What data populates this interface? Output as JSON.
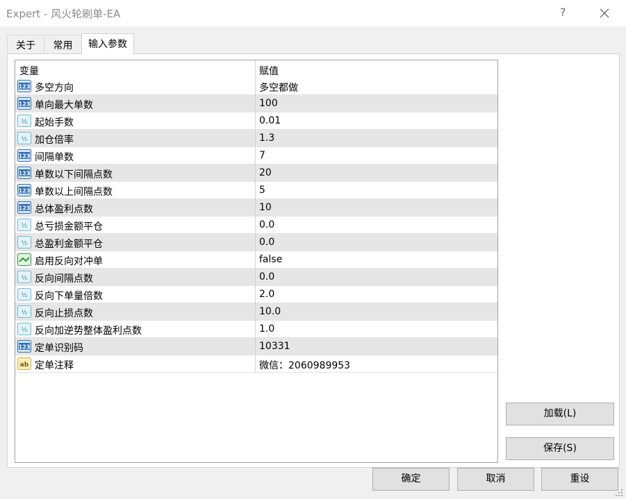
{
  "window": {
    "title": "Expert - 风火轮刷单-EA",
    "help_label": "?"
  },
  "tabs": [
    {
      "label": "关于"
    },
    {
      "label": "常用"
    },
    {
      "label": "输入参数"
    }
  ],
  "grid": {
    "col_variable": "变量",
    "col_value": "赋值",
    "rows": [
      {
        "icon": "integer-icon",
        "name": "多空方向",
        "value": "多空都做"
      },
      {
        "icon": "integer-icon",
        "name": "单向最大单数",
        "value": "100"
      },
      {
        "icon": "double-icon",
        "name": "起始手数",
        "value": "0.01"
      },
      {
        "icon": "double-icon",
        "name": "加仓倍率",
        "value": "1.3"
      },
      {
        "icon": "integer-icon",
        "name": "间隔单数",
        "value": "7"
      },
      {
        "icon": "integer-icon",
        "name": "单数以下间隔点数",
        "value": "20"
      },
      {
        "icon": "integer-icon",
        "name": "单数以上间隔点数",
        "value": "5"
      },
      {
        "icon": "integer-icon",
        "name": "总体盈利点数",
        "value": "10"
      },
      {
        "icon": "double-icon",
        "name": "总亏损金额平仓",
        "value": "0.0"
      },
      {
        "icon": "double-icon",
        "name": "总盈利金额平仓",
        "value": "0.0"
      },
      {
        "icon": "bool-icon",
        "name": "启用反向对冲单",
        "value": "false"
      },
      {
        "icon": "double-icon",
        "name": "反向间隔点数",
        "value": "0.0"
      },
      {
        "icon": "double-icon",
        "name": "反向下单量倍数",
        "value": "2.0"
      },
      {
        "icon": "double-icon",
        "name": "反向止损点数",
        "value": "10.0"
      },
      {
        "icon": "double-icon",
        "name": "反向加逆势整体盈利点数",
        "value": "1.0"
      },
      {
        "icon": "integer-icon",
        "name": "定单识别码",
        "value": "10331"
      },
      {
        "icon": "string-icon",
        "name": "定单注释",
        "value": "微信：2060989953"
      }
    ]
  },
  "buttons": {
    "load": "加载(L)",
    "save": "保存(S)",
    "ok": "确定",
    "cancel": "取消",
    "reset": "重设"
  },
  "colors": {
    "integer_icon": "#2f6fb5",
    "double_icon": "#6fb8d6",
    "bool_icon": "#2e9a3e",
    "string_icon": "#d9b23a"
  }
}
